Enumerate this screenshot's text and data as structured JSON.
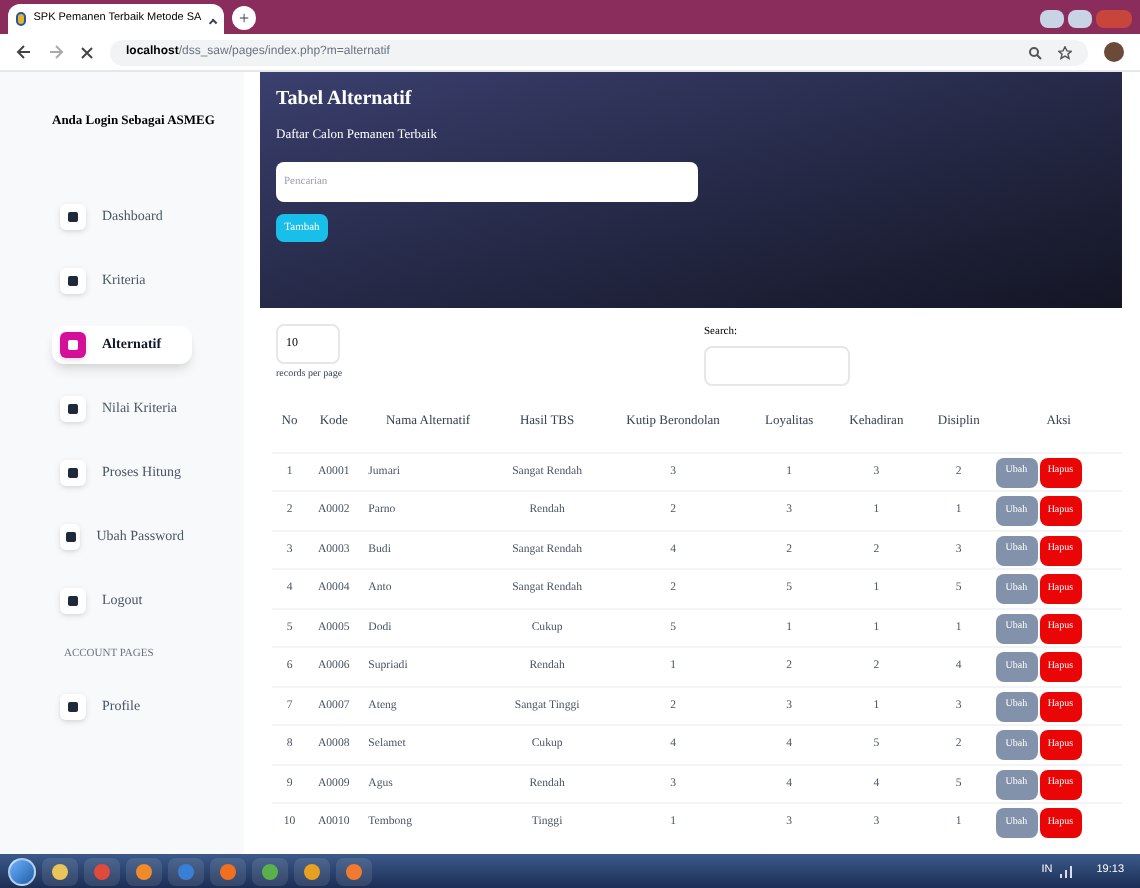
{
  "browser": {
    "tab_title": "SPK Pemanen Terbaik Metode SA",
    "new_tab": "+",
    "url_host": "localhost",
    "url_path": "/dss_saw/pages/index.php?m=alternatif"
  },
  "sidebar": {
    "user": "Anda Login Sebagai ASMEG",
    "items": [
      {
        "label": "Dashboard",
        "selected": false
      },
      {
        "label": "Kriteria",
        "selected": false
      },
      {
        "label": "Alternatif",
        "selected": true
      },
      {
        "label": "Nilai Kriteria",
        "selected": false
      },
      {
        "label": "Proses Hitung",
        "selected": false
      },
      {
        "label": "Ubah Password",
        "selected": false
      },
      {
        "label": "Logout",
        "selected": false
      }
    ],
    "section": "ACCOUNT PAGES",
    "section_items": [
      {
        "label": "Profile",
        "selected": false
      }
    ]
  },
  "header": {
    "title": "Tabel Alternatif",
    "subtitle": "Daftar Calon Pemanen Terbaik",
    "search": {
      "placeholder": "Pencarian"
    },
    "add_button": "Tambah"
  },
  "table": {
    "page_size": "10",
    "page_size_label": "records per page",
    "search_label": "Search:",
    "columns": [
      "No",
      "Kode",
      "Nama Alternatif",
      "Hasil TBS",
      "Kutip Berondolan",
      "Loyalitas",
      "Kehadiran",
      "Disiplin",
      "Aksi"
    ],
    "rows": [
      {
        "cells": [
          "1",
          "A0001",
          "Jumari",
          "Sangat Rendah",
          "3",
          "1",
          "3",
          "2"
        ],
        "edit": "Ubah",
        "delete": "Hapus"
      },
      {
        "cells": [
          "2",
          "A0002",
          "Parno",
          "Rendah",
          "2",
          "3",
          "1",
          "1"
        ],
        "edit": "Ubah",
        "delete": "Hapus"
      },
      {
        "cells": [
          "3",
          "A0003",
          "Budi",
          "Sangat Rendah",
          "4",
          "2",
          "2",
          "3"
        ],
        "edit": "Ubah",
        "delete": "Hapus"
      },
      {
        "cells": [
          "4",
          "A0004",
          "Anto",
          "Sangat Rendah",
          "2",
          "5",
          "1",
          "5"
        ],
        "edit": "Ubah",
        "delete": "Hapus"
      },
      {
        "cells": [
          "5",
          "A0005",
          "Dodi",
          "Cukup",
          "5",
          "1",
          "1",
          "1"
        ],
        "edit": "Ubah",
        "delete": "Hapus"
      },
      {
        "cells": [
          "6",
          "A0006",
          "Supriadi",
          "Rendah",
          "1",
          "2",
          "2",
          "4"
        ],
        "edit": "Ubah",
        "delete": "Hapus"
      },
      {
        "cells": [
          "7",
          "A0007",
          "Ateng",
          "Sangat Tinggi",
          "2",
          "3",
          "1",
          "3"
        ],
        "edit": "Ubah",
        "delete": "Hapus"
      },
      {
        "cells": [
          "8",
          "A0008",
          "Selamet",
          "Cukup",
          "4",
          "4",
          "5",
          "2"
        ],
        "edit": "Ubah",
        "delete": "Hapus"
      },
      {
        "cells": [
          "9",
          "A0009",
          "Agus",
          "Rendah",
          "3",
          "4",
          "4",
          "5"
        ],
        "edit": "Ubah",
        "delete": "Hapus"
      },
      {
        "cells": [
          "10",
          "A0010",
          "Tembong",
          "Tinggi",
          "1",
          "3",
          "3",
          "1"
        ],
        "edit": "Ubah",
        "delete": "Hapus"
      }
    ]
  },
  "taskbar": {
    "language": "IN",
    "clock": "19:13"
  }
}
